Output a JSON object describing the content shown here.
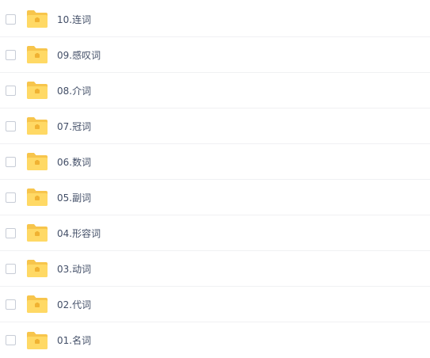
{
  "file_list": {
    "icon": "folder-icon",
    "folder_colors": {
      "back": "#f7c54c",
      "front": "#ffd965",
      "emblem": "#f0b232"
    },
    "items": [
      {
        "name": "10.连词"
      },
      {
        "name": "09.感叹词"
      },
      {
        "name": "08.介词"
      },
      {
        "name": "07.冠词"
      },
      {
        "name": "06.数词"
      },
      {
        "name": "05.副词"
      },
      {
        "name": "04.形容词"
      },
      {
        "name": "03.动词"
      },
      {
        "name": "02.代词"
      },
      {
        "name": "01.名词"
      }
    ]
  }
}
